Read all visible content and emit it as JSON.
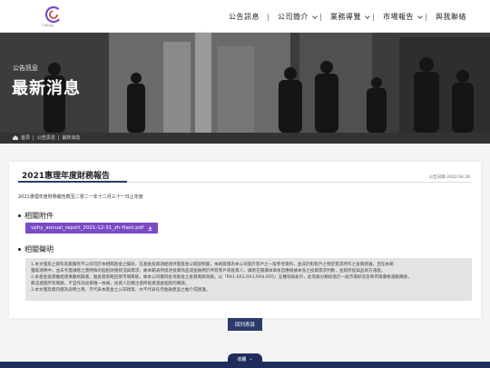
{
  "header": {
    "logo_text": "Cathay",
    "nav": [
      {
        "label": "公告訊息",
        "has_arrow": false
      },
      {
        "label": "公司簡介",
        "has_arrow": true
      },
      {
        "label": "業務導覽",
        "has_arrow": true
      },
      {
        "label": "市場報告",
        "has_arrow": true
      },
      {
        "label": "與我聯絡",
        "has_arrow": false
      }
    ]
  },
  "banner": {
    "subtitle": "公告訊息",
    "title": "最新消息"
  },
  "breadcrumb": [
    "首頁",
    "公告訊息",
    "最新消息"
  ],
  "article": {
    "title": "2021惠理年度財務報告",
    "date": "公告日期 2022.04.28",
    "summary": "2021惠理年度財務報告截至二零二一年十二月三十一日止年度",
    "attachments_heading": "相關附件",
    "attachment_label": "vphy_annual_report_2021-12-31_zh-Hant.pdf",
    "disclaimer_heading": "相關聲明",
    "disclaimer_lines": [
      "1.本文僅及之資料及無獨有不公均可於本相關基金之績效，在基金投資須經謹評量基金公開說明書，本網簽僅為本公司基於客戶之一般參考資料，並非針對客戶之特定需求所作之投資建議，且在本網",
      "獲取適時中，並未考量讀者之需特殊的個別財務狀況與需求，故本範表所提述投資商品或金融用於所有客戶或投資人，讀者在閱讀本章後自應根據本身之投資需求判斷，並就所提與品商方適基。",
      "2.本基金投資雖經謹慎嚴格篩選，惟投資策略且受市場風險，故本公司獲得各項基金之投資風險等級，以「RR1,RR2,RR3,RR4,RR5」五種等級表示，此等級分類係基於一般市場狀況反映市場價格波動風險，",
      "無法涵蓋所有風險，不宜作為投資唯一依據，投資人仍應注意所投資基金個別的風險。",
      "3.本文僅及資訊僅為說明之用，不代表本基金之公司政策，亦不代表任何金融產品之推介或建議。"
    ],
    "back_label": "回列表頁"
  },
  "footer": {
    "tab_label": "收闔"
  },
  "colors": {
    "accent_navy": "#2b3a6b",
    "attachment_purple": "#7a4bc4",
    "footer_navy": "#1f2d5c"
  }
}
